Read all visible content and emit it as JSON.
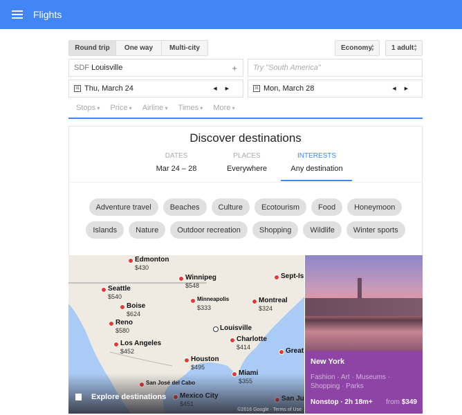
{
  "header": {
    "title": "Flights",
    "menu_icon": "hamburger-icon",
    "color": "#4285f4"
  },
  "trip_types": [
    "Round trip",
    "One way",
    "Multi-city"
  ],
  "selected_trip_type": "Round trip",
  "cabin": "Economy",
  "passengers": "1 adult",
  "origin": {
    "code": "SDF",
    "city": "Louisville"
  },
  "destination_placeholder": "Try \"South America\"",
  "depart_date": "Thu, March 24",
  "return_date": "Mon, March 28",
  "filters": [
    "Stops",
    "Price",
    "Airline",
    "Times",
    "More"
  ],
  "discover": {
    "title": "Discover destinations",
    "tabs": [
      {
        "label": "DATES",
        "value": "Mar 24 – 28"
      },
      {
        "label": "PLACES",
        "value": "Everywhere"
      },
      {
        "label": "INTERESTS",
        "value": "Any destination"
      }
    ],
    "active_tab": "INTERESTS",
    "interests": [
      "Adventure travel",
      "Beaches",
      "Culture",
      "Ecotourism",
      "Food",
      "Honeymoon",
      "Islands",
      "Nature",
      "Outdoor recreation",
      "Shopping",
      "Wildlife",
      "Winter sports"
    ]
  },
  "map": {
    "cities": [
      {
        "name": "Edmonton",
        "price": "$430"
      },
      {
        "name": "Winnipeg",
        "price": "$548"
      },
      {
        "name": "Sept-Is",
        "price": ""
      },
      {
        "name": "Seattle",
        "price": "$540"
      },
      {
        "name": "Boise",
        "price": "$624"
      },
      {
        "name": "Minneapolis",
        "price": "$333"
      },
      {
        "name": "Montreal",
        "price": "$324"
      },
      {
        "name": "Reno",
        "price": "$580"
      },
      {
        "name": "Louisville",
        "price": ""
      },
      {
        "name": "Charlotte",
        "price": "$414"
      },
      {
        "name": "Los Angeles",
        "price": "$452"
      },
      {
        "name": "Great",
        "price": ""
      },
      {
        "name": "Houston",
        "price": "$495"
      },
      {
        "name": "Miami",
        "price": "$355"
      },
      {
        "name": "San José del Cabo",
        "price": ""
      },
      {
        "name": "Mexico City",
        "price": "$451"
      },
      {
        "name": "San Ju",
        "price": ""
      }
    ],
    "explore_label": "Explore destinations",
    "copyright": "©2016 Google · Terms of Use"
  },
  "featured": {
    "name": "New York",
    "tags": "Fashion · Art · Museums · Shopping · Parks",
    "flight": "Nonstop · 2h 18m+",
    "from_label": "from",
    "price": "$349",
    "color": "#8e44a4"
  }
}
